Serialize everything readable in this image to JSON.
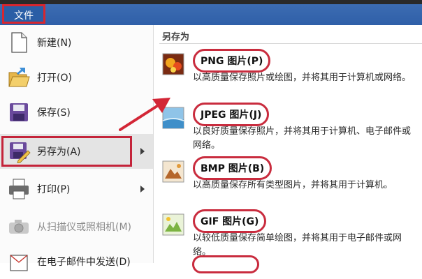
{
  "menu": {
    "file_tab": "文件"
  },
  "left_items": [
    {
      "label": "新建(N)",
      "icon": "new-document-icon"
    },
    {
      "label": "打开(O)",
      "icon": "open-folder-icon"
    },
    {
      "label": "保存(S)",
      "icon": "save-floppy-icon"
    },
    {
      "label": "另存为(A)",
      "icon": "save-as-icon",
      "selected": true,
      "has_submenu": true
    },
    {
      "label": "打印(P)",
      "icon": "printer-icon",
      "has_submenu": true
    },
    {
      "label": "从扫描仪或照相机(M)",
      "icon": "scanner-camera-icon",
      "disabled": true
    },
    {
      "label": "在电子邮件中发送(D)",
      "icon": "email-icon"
    }
  ],
  "save_as": {
    "title": "另存为",
    "formats": [
      {
        "name": "PNG 图片(P)",
        "desc": "以高质量保存照片或绘图，并将其用于计算机或网络。",
        "icon": "png-image-icon"
      },
      {
        "name": "JPEG 图片(J)",
        "desc": "以良好质量保存照片，并将其用于计算机、电子邮件或网络。",
        "icon": "jpeg-image-icon"
      },
      {
        "name": "BMP 图片(B)",
        "desc": "以高质量保存所有类型图片，并将其用于计算机。",
        "icon": "bmp-image-icon"
      },
      {
        "name": "GIF 图片(G)",
        "desc": "以较低质量保存简单绘图，并将其用于电子邮件或网络。",
        "icon": "gif-image-icon"
      }
    ]
  },
  "colors": {
    "accent_blue": "#2f5fa8",
    "highlight_red": "#c92c3e"
  }
}
